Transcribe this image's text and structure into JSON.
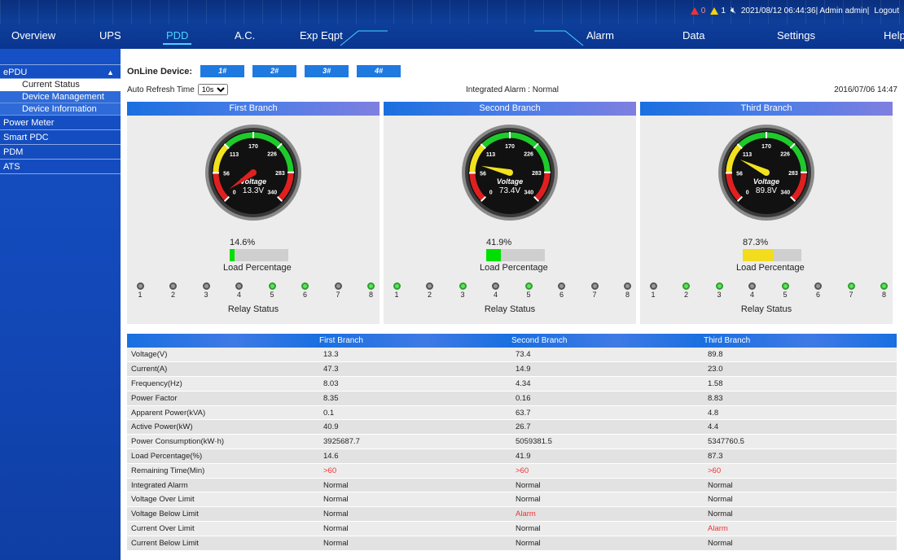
{
  "topbar": {
    "red_alarm_count": "0",
    "yellow_alarm_count": "1",
    "status_text": "2021/08/12 06:44:36| Admin admin|",
    "logout_label": "Logout",
    "alarm_red_color": "#e33333",
    "alarm_yellow_color": "#f5d400"
  },
  "nav": {
    "items": [
      "Overview",
      "UPS",
      "PDD",
      "A.C.",
      "Exp Eqpt",
      "Alarm",
      "Data",
      "Settings",
      "Help"
    ],
    "active_index": 2,
    "active_color": "#49d4ff"
  },
  "sidebar": {
    "epdu": {
      "label": "ePDU",
      "caret": "▲",
      "children": [
        "Current Status",
        "Device Management",
        "Device Information"
      ]
    },
    "sections": [
      "Power Meter",
      "Smart PDC",
      "PDM",
      "ATS"
    ]
  },
  "online": {
    "label": "OnLine Device:",
    "devices": [
      "1#",
      "2#",
      "3#",
      "4#"
    ]
  },
  "refresh": {
    "label": "Auto Refresh Time",
    "options": [
      "10s"
    ],
    "selected": "10s"
  },
  "alarm_status": "Integrated Alarm : Normal",
  "datetime": "2016/07/06 14:47",
  "gauge": {
    "ticks": [
      "0",
      "56",
      "113",
      "170",
      "226",
      "283",
      "340"
    ],
    "max": 340,
    "label": "Voltage"
  },
  "branches": [
    {
      "name": "First Branch",
      "voltage": 13.3,
      "voltage_text": "13.3V",
      "load_pct": 14.6,
      "load_text": "14.6%",
      "bar_color": "#00e000",
      "relays_on": [
        5,
        6,
        8
      ]
    },
    {
      "name": "Second Branch",
      "voltage": 73.4,
      "voltage_text": "73.4V",
      "load_pct": 41.9,
      "load_text": "41.9%",
      "bar_color": "#00e000",
      "relays_on": [
        1,
        3,
        5
      ]
    },
    {
      "name": "Third Branch",
      "voltage": 89.8,
      "voltage_text": "89.8V",
      "load_pct": 87.3,
      "load_text": "87.3%",
      "bar_color": "#f2dc1e",
      "relays_on": [
        2,
        3,
        5,
        7,
        8
      ]
    }
  ],
  "load_label": "Load Percentage",
  "relay_label": "Relay Status",
  "relay_numbers": [
    "1",
    "2",
    "3",
    "4",
    "5",
    "6",
    "7",
    "8"
  ],
  "table": {
    "headers": [
      "",
      "First Branch",
      "Second Branch",
      "Third Branch"
    ],
    "rows": [
      [
        "Voltage(V)",
        "13.3",
        "73.4",
        "89.8"
      ],
      [
        "Current(A)",
        "47.3",
        "14.9",
        "23.0"
      ],
      [
        "Frequency(Hz)",
        "8.03",
        "4.34",
        "1.58"
      ],
      [
        "Power Factor",
        "8.35",
        "0.16",
        "8.83"
      ],
      [
        "Apparent Power(kVA)",
        "0.1",
        "63.7",
        "4.8"
      ],
      [
        "Active Power(kW)",
        "40.9",
        "26.7",
        "4.4"
      ],
      [
        "Power Consumption(kW·h)",
        "3925687.7",
        "5059381.5",
        "5347760.5"
      ],
      [
        "Load Percentage(%)",
        "14.6",
        "41.9",
        "87.3"
      ],
      [
        "Remaining Time(Min)",
        ">60",
        ">60",
        ">60"
      ],
      [
        "Integrated Alarm",
        "Normal",
        "Normal",
        "Normal"
      ],
      [
        "Voltage Over Limit",
        "Normal",
        "Normal",
        "Normal"
      ],
      [
        "Voltage Below Limit",
        "Normal",
        "Alarm",
        "Normal"
      ],
      [
        "Current Over Limit",
        "Normal",
        "Normal",
        "Alarm"
      ],
      [
        "Current Below Limit",
        "Normal",
        "Normal",
        "Normal"
      ]
    ],
    "alert_values": [
      ">60",
      "Alarm"
    ],
    "alert_color": "#e33333"
  }
}
